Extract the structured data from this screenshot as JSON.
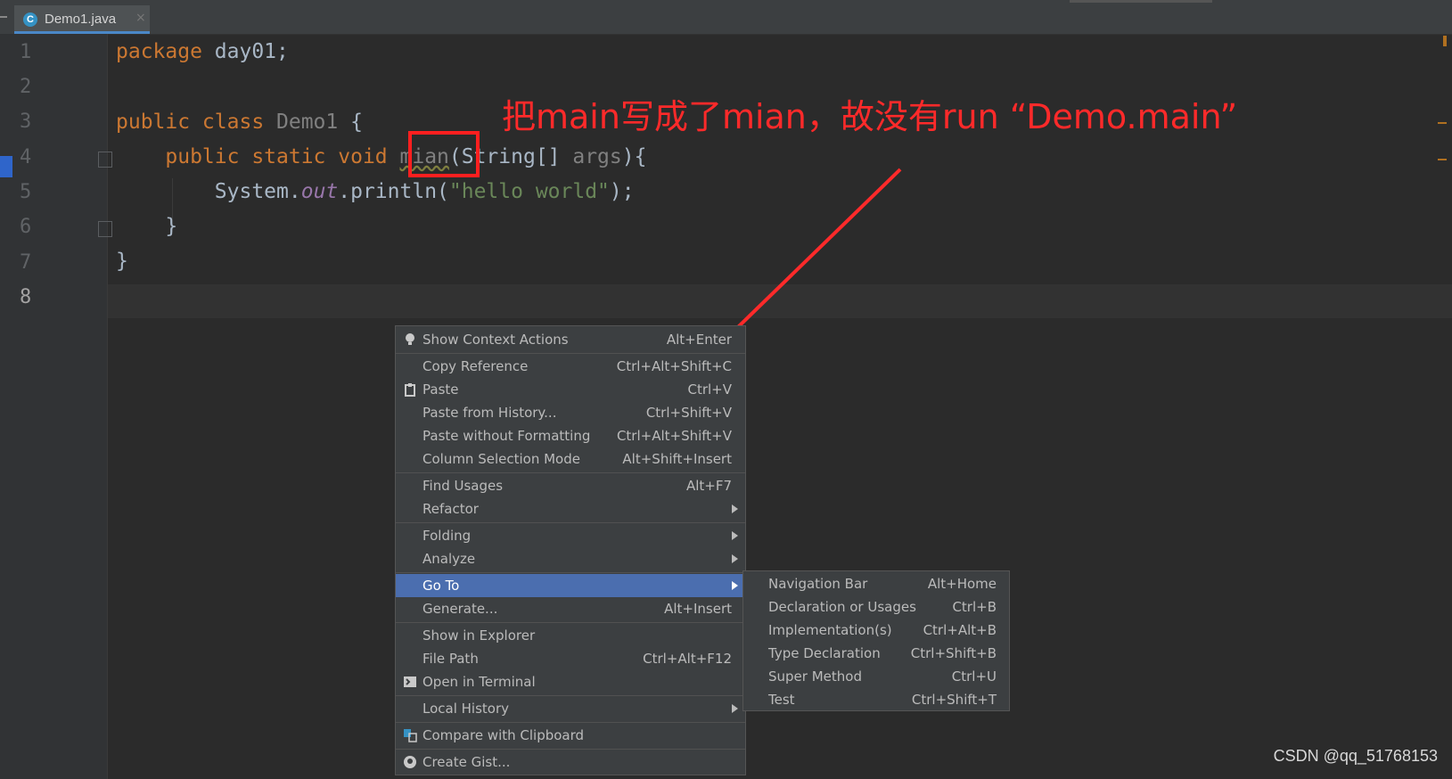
{
  "tab": {
    "icon_letter": "C",
    "label": "Demo1.java",
    "close": "×"
  },
  "gutter": {
    "line_numbers": [
      "1",
      "2",
      "3",
      "4",
      "5",
      "6",
      "7",
      "8"
    ]
  },
  "code": {
    "l1_kw": "package",
    "l1_rest": " day01;",
    "l3_kw": "public class",
    "l3_name": " Demo1",
    "l3_rest": " {",
    "l4_kw": "    public static void",
    "l4_sp": " ",
    "l4_method": "mian",
    "l4_paren": "(String[]",
    "l4_args": " args",
    "l4_end": "){",
    "l5_a": "        System.",
    "l5_out": "out",
    "l5_b": ".println(",
    "l5_str": "\"hello world\"",
    "l5_c": ");",
    "l6": "    }",
    "l7": "}"
  },
  "annotation": {
    "text": "把main写成了mian，故没有run “Demo.main”",
    "color": "#ff2a2a"
  },
  "context_menu": {
    "items": [
      {
        "label": "Show Context Actions",
        "shortcut": "Alt+Enter",
        "icon": "lightbulb-icon"
      },
      {
        "label": "Copy Reference",
        "shortcut": "Ctrl+Alt+Shift+C"
      },
      {
        "label": "Paste",
        "shortcut": "Ctrl+V",
        "icon": "clipboard-icon"
      },
      {
        "label": "Paste from History...",
        "shortcut": "Ctrl+Shift+V"
      },
      {
        "label": "Paste without Formatting",
        "shortcut": "Ctrl+Alt+Shift+V"
      },
      {
        "label": "Column Selection Mode",
        "shortcut": "Alt+Shift+Insert"
      },
      {
        "label": "Find Usages",
        "shortcut": "Alt+F7"
      },
      {
        "label": "Refactor",
        "shortcut": ""
      },
      {
        "label": "Folding",
        "shortcut": ""
      },
      {
        "label": "Analyze",
        "shortcut": ""
      },
      {
        "label": "Go To",
        "shortcut": ""
      },
      {
        "label": "Generate...",
        "shortcut": "Alt+Insert"
      },
      {
        "label": "Show in Explorer",
        "shortcut": ""
      },
      {
        "label": "File Path",
        "shortcut": "Ctrl+Alt+F12"
      },
      {
        "label": "Open in Terminal",
        "shortcut": "",
        "icon": "terminal-icon"
      },
      {
        "label": "Local History",
        "shortcut": ""
      },
      {
        "label": "Compare with Clipboard",
        "shortcut": "",
        "icon": "compare-icon"
      },
      {
        "label": "Create Gist...",
        "shortcut": "",
        "icon": "github-icon"
      }
    ]
  },
  "submenu": {
    "items": [
      {
        "label": "Navigation Bar",
        "shortcut": "Alt+Home"
      },
      {
        "label": "Declaration or Usages",
        "shortcut": "Ctrl+B"
      },
      {
        "label": "Implementation(s)",
        "shortcut": "Ctrl+Alt+B"
      },
      {
        "label": "Type Declaration",
        "shortcut": "Ctrl+Shift+B"
      },
      {
        "label": "Super Method",
        "shortcut": "Ctrl+U"
      },
      {
        "label": "Test",
        "shortcut": "Ctrl+Shift+T"
      }
    ]
  },
  "watermark": "CSDN @qq_51768153",
  "colors": {
    "menu_bg": "#3c3f41",
    "selection": "#4b6eaf",
    "editor_bg": "#2b2b2b",
    "keyword": "#cc7832",
    "string": "#6a8759"
  }
}
